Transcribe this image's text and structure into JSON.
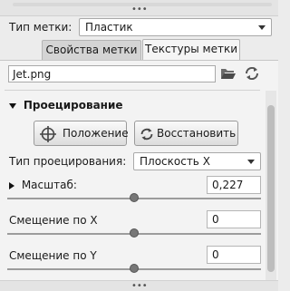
{
  "grip_top": {
    "dots": "•••"
  },
  "label_type": {
    "label": "Тип метки:",
    "value": "Пластик"
  },
  "tabs": [
    {
      "label": "Свойства метки",
      "active": false
    },
    {
      "label": "Текстуры метки",
      "active": true
    }
  ],
  "texture": {
    "filename": "Jet.png",
    "open_icon": "folder-open-icon",
    "reload_icon": "refresh-icon"
  },
  "projection": {
    "section_title": "Проецирование",
    "position_button": "Положение",
    "restore_button": "Восстановить",
    "type_label": "Тип проецирования:",
    "type_value": "Плоскость X",
    "scale": {
      "label": "Масштаб:",
      "value": "0,227",
      "slider_fraction": 0.5
    },
    "offset_x": {
      "label": "Смещение по X",
      "value": "0",
      "slider_fraction": 0.5
    },
    "offset_y": {
      "label": "Смещение по Y",
      "value": "0",
      "slider_fraction": 0.5
    }
  },
  "grip_bottom": {
    "dots": "•••"
  }
}
